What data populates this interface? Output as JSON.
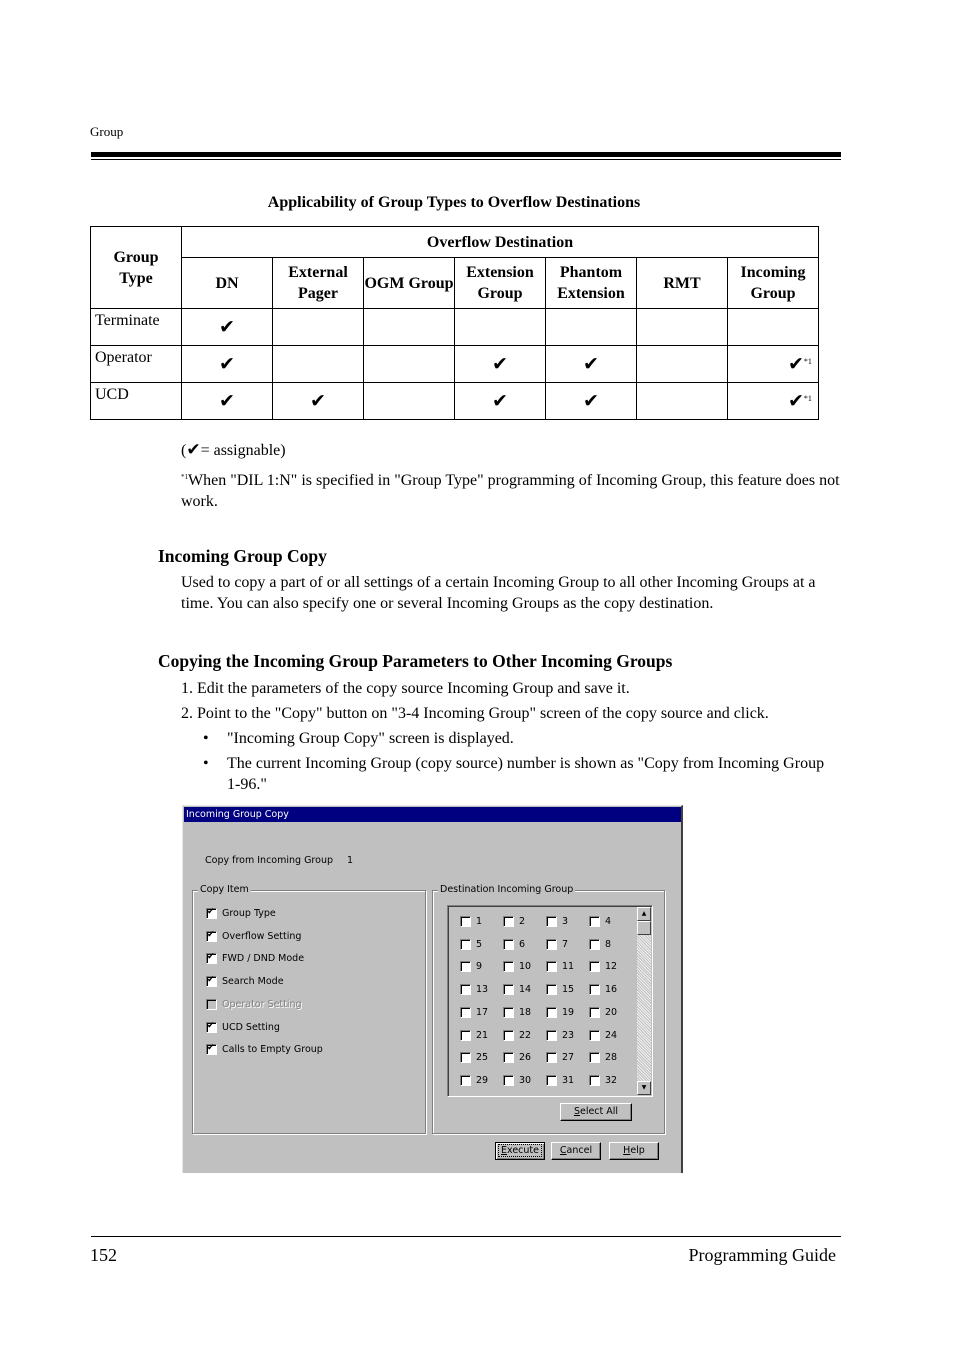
{
  "header": {
    "running_head": "Group"
  },
  "table": {
    "title": "Applicability of Group Types to Overflow Destinations",
    "group_type_header": "Group Type",
    "overflow_header": "Overflow Destination",
    "columns": [
      "DN",
      "External Pager",
      "OGM Group",
      "Extension Group",
      "Phantom Extension",
      "RMT",
      "Incoming Group"
    ],
    "check_glyph": "✔",
    "note_marker": "*1",
    "rows": [
      {
        "label": "Terminate",
        "cells": [
          true,
          false,
          false,
          false,
          false,
          false,
          false
        ],
        "notes": [
          false,
          false,
          false,
          false,
          false,
          false,
          false
        ]
      },
      {
        "label": "Operator",
        "cells": [
          true,
          false,
          false,
          true,
          true,
          false,
          true
        ],
        "notes": [
          false,
          false,
          false,
          false,
          false,
          false,
          true
        ]
      },
      {
        "label": "UCD",
        "cells": [
          true,
          true,
          false,
          true,
          true,
          false,
          true
        ],
        "notes": [
          false,
          false,
          false,
          false,
          false,
          false,
          true
        ]
      }
    ]
  },
  "legend": {
    "open": "(",
    "text": "= assignable)"
  },
  "footnote": {
    "marker": "*1",
    "text": "When \"DIL 1:N\" is specified in \"Group Type\" programming of Incoming Group, this feature does not work."
  },
  "section_incoming_group_copy": {
    "heading": "Incoming Group Copy",
    "body": "Used to copy a part of or all settings of a certain Incoming Group to all other Incoming Groups at a time. You can also specify one or several Incoming Groups as the copy destination."
  },
  "section_copying": {
    "heading": "Copying the Incoming Group Parameters to Other Incoming Groups",
    "steps": [
      "1. Edit the parameters of the copy source Incoming Group and save it.",
      "2. Point to the \"Copy\" button on \"3-4 Incoming Group\" screen of the copy source and click."
    ],
    "bullets": [
      "\"Incoming Group Copy\" screen is displayed.",
      "The current Incoming Group (copy source) number is shown as \"Copy from Incoming Group 1-96.\""
    ],
    "bullet_glyph": "•"
  },
  "dialog": {
    "title": "Incoming Group Copy",
    "copy_from_label": "Copy from Incoming Group",
    "copy_from_value": "1",
    "copy_item_label": "Copy Item",
    "copy_items": [
      {
        "label": "Group Type",
        "checked": true,
        "enabled": true
      },
      {
        "label": "Overflow Setting",
        "checked": true,
        "enabled": true
      },
      {
        "label": "FWD / DND Mode",
        "checked": true,
        "enabled": true
      },
      {
        "label": "Search Mode",
        "checked": true,
        "enabled": true
      },
      {
        "label": "Operator Setting",
        "checked": false,
        "enabled": false
      },
      {
        "label": "UCD Setting",
        "checked": true,
        "enabled": true
      },
      {
        "label": "Calls to Empty Group",
        "checked": true,
        "enabled": true
      }
    ],
    "destination_label": "Destination Incoming Group",
    "destinations": [
      {
        "n": "1",
        "checked": false
      },
      {
        "n": "2",
        "checked": false
      },
      {
        "n": "3",
        "checked": false
      },
      {
        "n": "4",
        "checked": false
      },
      {
        "n": "5",
        "checked": false
      },
      {
        "n": "6",
        "checked": false
      },
      {
        "n": "7",
        "checked": false
      },
      {
        "n": "8",
        "checked": false
      },
      {
        "n": "9",
        "checked": false
      },
      {
        "n": "10",
        "checked": false
      },
      {
        "n": "11",
        "checked": false
      },
      {
        "n": "12",
        "checked": false
      },
      {
        "n": "13",
        "checked": false
      },
      {
        "n": "14",
        "checked": false
      },
      {
        "n": "15",
        "checked": false
      },
      {
        "n": "16",
        "checked": false
      },
      {
        "n": "17",
        "checked": false
      },
      {
        "n": "18",
        "checked": false
      },
      {
        "n": "19",
        "checked": false
      },
      {
        "n": "20",
        "checked": false
      },
      {
        "n": "21",
        "checked": false
      },
      {
        "n": "22",
        "checked": false
      },
      {
        "n": "23",
        "checked": false
      },
      {
        "n": "24",
        "checked": false
      },
      {
        "n": "25",
        "checked": false
      },
      {
        "n": "26",
        "checked": false
      },
      {
        "n": "27",
        "checked": false
      },
      {
        "n": "28",
        "checked": false
      },
      {
        "n": "29",
        "checked": false
      },
      {
        "n": "30",
        "checked": false
      },
      {
        "n": "31",
        "checked": false
      },
      {
        "n": "32",
        "checked": false
      }
    ],
    "scroll_up_glyph": "▲",
    "scroll_down_glyph": "▼",
    "buttons": {
      "select_all": {
        "mnemonic": "S",
        "rest": "elect All"
      },
      "execute": {
        "mnemonic": "E",
        "rest": "xecute"
      },
      "cancel": {
        "mnemonic": "C",
        "rest": "ancel"
      },
      "help": {
        "mnemonic": "H",
        "rest": "elp"
      }
    }
  },
  "footer": {
    "page_number": "152",
    "book_title": "Programming Guide"
  }
}
